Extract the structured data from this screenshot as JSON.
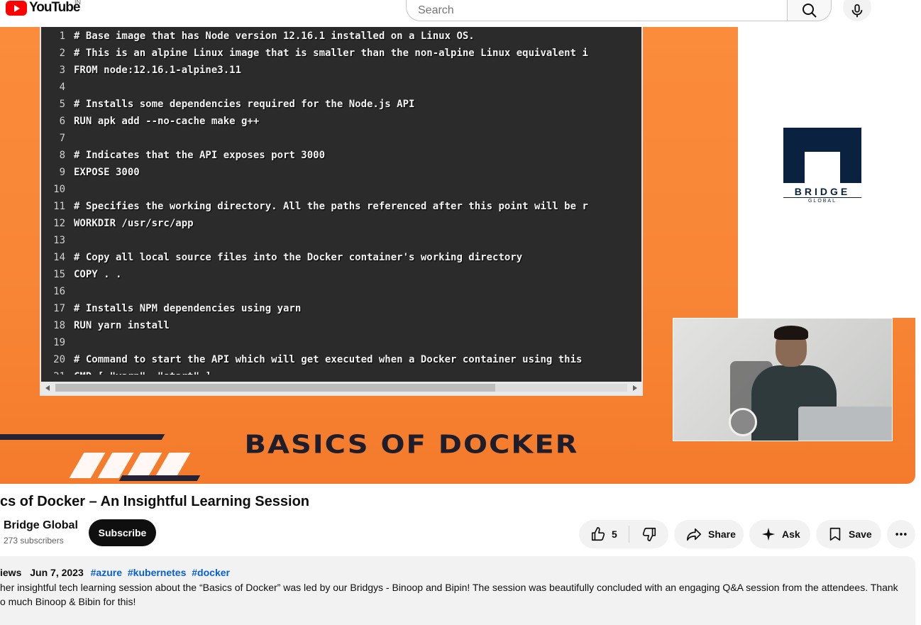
{
  "header": {
    "logo_text": "YouTube",
    "region": "IN",
    "search_placeholder": "Search"
  },
  "video": {
    "code_lines": [
      {
        "n": "1",
        "text": "# Base image that has Node version 12.16.1 installed on a Linux OS."
      },
      {
        "n": "2",
        "text": "# This is an alpine Linux image that is smaller than the non-alpine Linux equivalent i"
      },
      {
        "n": "3",
        "text": "FROM node:12.16.1-alpine3.11"
      },
      {
        "n": "4",
        "text": ""
      },
      {
        "n": "5",
        "text": "# Installs some dependencies required for the Node.js API"
      },
      {
        "n": "6",
        "text": "RUN apk add --no-cache make g++"
      },
      {
        "n": "7",
        "text": ""
      },
      {
        "n": "8",
        "text": "# Indicates that the API exposes port 3000"
      },
      {
        "n": "9",
        "text": "EXPOSE 3000"
      },
      {
        "n": "10",
        "text": ""
      },
      {
        "n": "11",
        "text": "# Specifies the working directory. All the paths referenced after this point will be r"
      },
      {
        "n": "12",
        "text": "WORKDIR /usr/src/app"
      },
      {
        "n": "13",
        "text": ""
      },
      {
        "n": "14",
        "text": "# Copy all local source files into the Docker container's working directory"
      },
      {
        "n": "15",
        "text": "COPY . ."
      },
      {
        "n": "16",
        "text": ""
      },
      {
        "n": "17",
        "text": "# Installs NPM dependencies using yarn"
      },
      {
        "n": "18",
        "text": "RUN yarn install"
      },
      {
        "n": "19",
        "text": ""
      },
      {
        "n": "20",
        "text": "# Command to start the API which will get executed when a Docker container using this"
      },
      {
        "n": "21",
        "text": "CMD [ \"yarn\", \"start\" ]"
      }
    ],
    "brand_word": "BRIDGE",
    "brand_sub": "GLOBAL",
    "banner_title": "BASICS OF DOCKER"
  },
  "details": {
    "title": "cs of Docker – An Insightful Learning Session",
    "channel_name": "Bridge Global",
    "subscribers": "273 subscribers",
    "subscribe_label": "Subscribe",
    "like_count": "5",
    "share_label": "Share",
    "ask_label": "Ask",
    "save_label": "Save"
  },
  "description": {
    "views": "iews",
    "date": "Jun 7, 2023",
    "hashtags": [
      "#azure",
      "#kubernetes",
      "#docker"
    ],
    "text": "her insightful tech learning session about the “Basics of Docker” was led by our Bridgys - Binoop and Bipin! The session was beautifully concluded with an engaging Q&A session from the attendees. Thank o much Binoop & Bibin for this!"
  },
  "colors": {
    "brand_red": "#ff0000",
    "banner_orange": "#f78535",
    "navy": "#0a2240",
    "link_blue": "#065fd4"
  }
}
